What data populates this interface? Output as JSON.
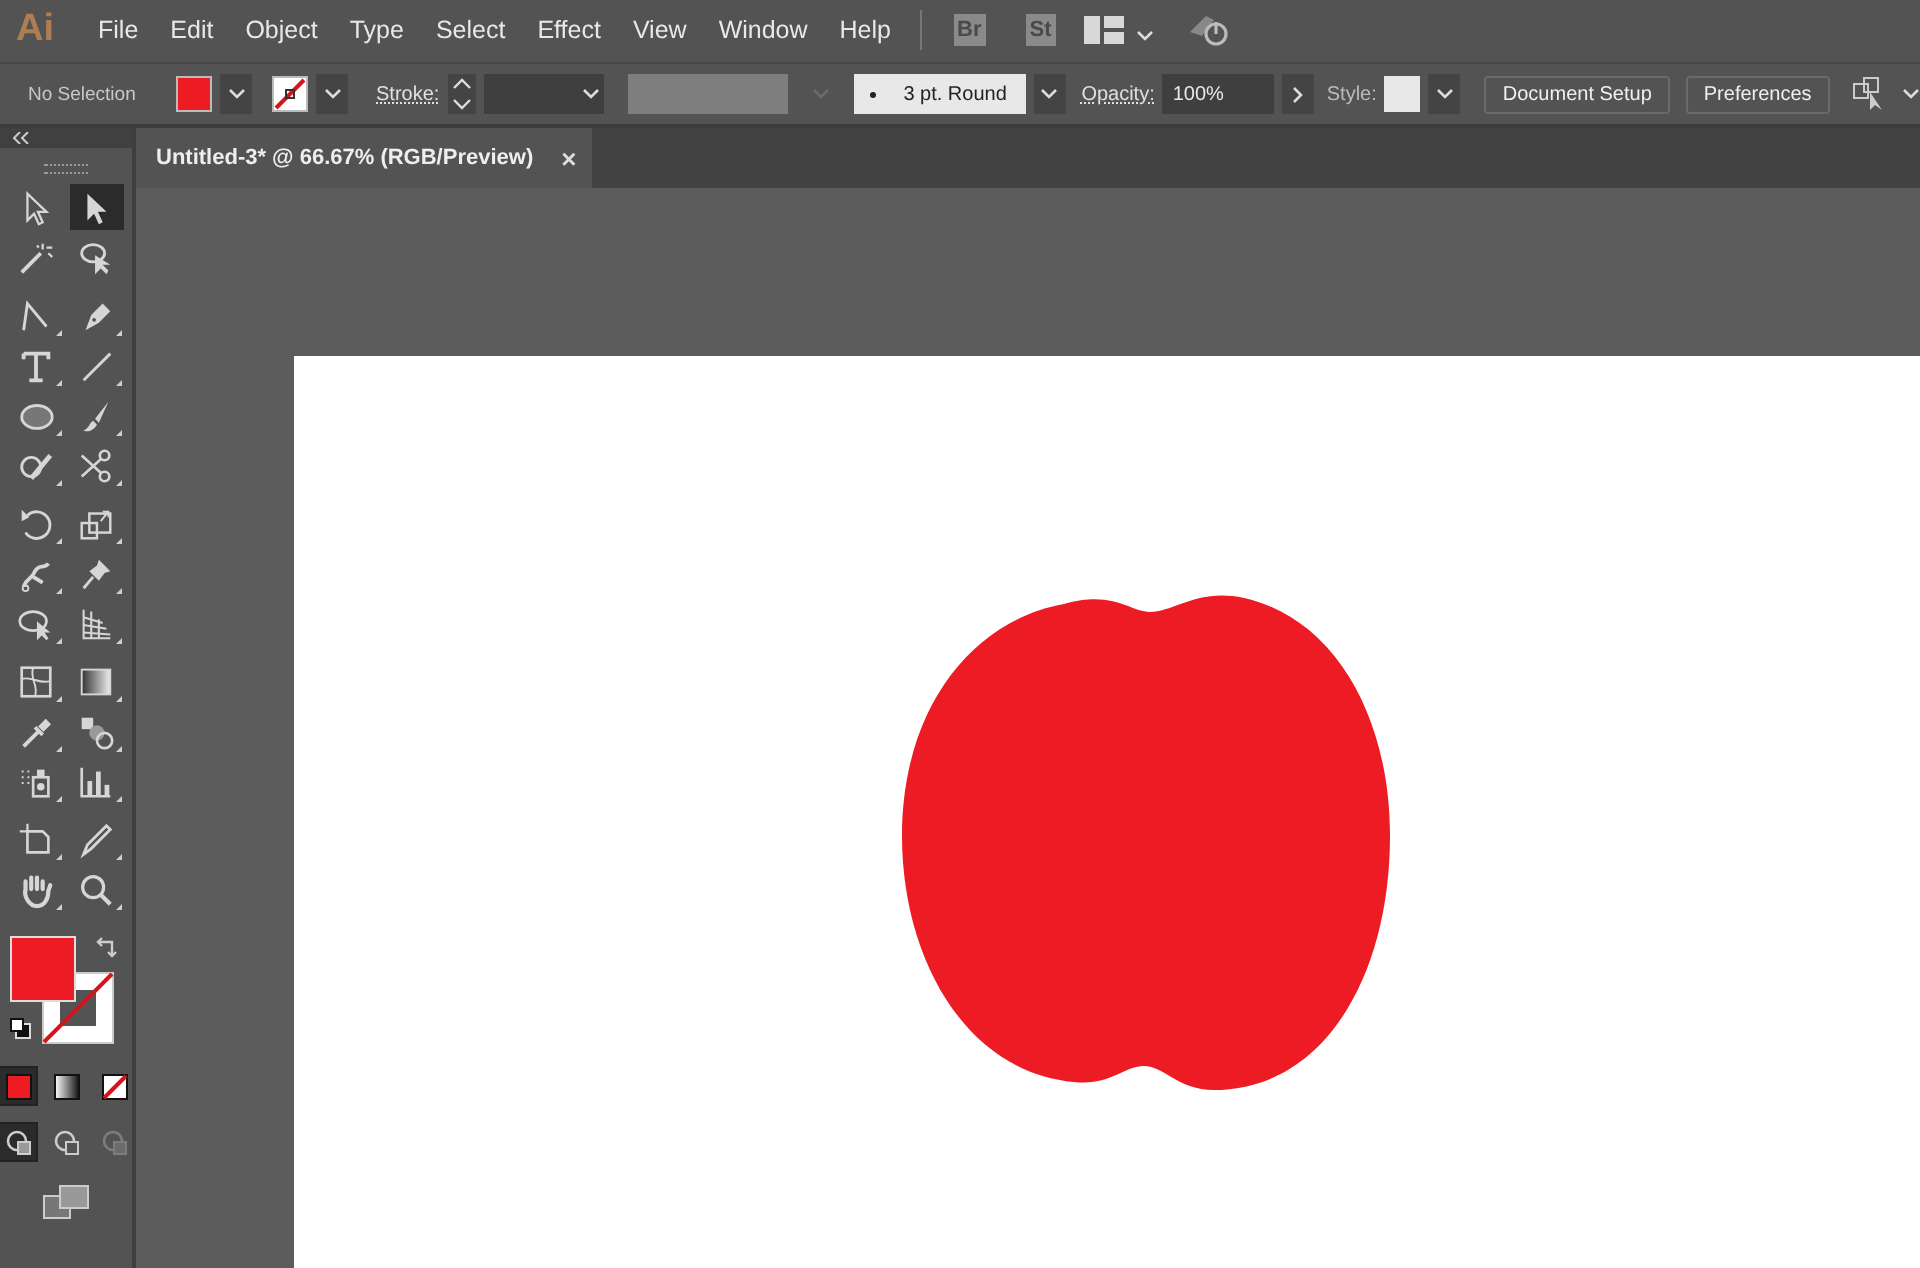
{
  "app_logo": "Ai",
  "menu": [
    "File",
    "Edit",
    "Object",
    "Type",
    "Select",
    "Effect",
    "View",
    "Window",
    "Help"
  ],
  "bridge_badges": [
    "Br",
    "St"
  ],
  "control_bar": {
    "selection_label": "No Selection",
    "fill": {
      "color": "#ed1c24"
    },
    "stroke_label": "Stroke:",
    "brush": "3 pt. Round",
    "opacity_label": "Opacity:",
    "opacity": "100%",
    "style_label": "Style:",
    "buttons": [
      "Document Setup",
      "Preferences"
    ]
  },
  "document_tab": {
    "title": "Untitled-3* @ 66.67% (RGB/Preview)",
    "close": "×",
    "selected": true
  },
  "tools": [
    {
      "kind": "direct-selection",
      "selected": false
    },
    {
      "kind": "selection",
      "selected": true
    },
    {
      "kind": "magic-wand",
      "selected": false
    },
    {
      "kind": "lasso",
      "selected": false
    },
    {
      "kind": "curvature",
      "selected": false
    },
    {
      "kind": "pen",
      "selected": false
    },
    {
      "kind": "type",
      "selected": false
    },
    {
      "kind": "line",
      "selected": false
    },
    {
      "kind": "ellipse",
      "selected": false
    },
    {
      "kind": "paintbrush",
      "selected": false
    },
    {
      "kind": "shaper",
      "selected": false
    },
    {
      "kind": "scissors",
      "selected": false
    },
    {
      "kind": "rotate",
      "selected": false
    },
    {
      "kind": "scale",
      "selected": false
    },
    {
      "kind": "puppet-warp",
      "selected": false
    },
    {
      "kind": "pin",
      "selected": false
    },
    {
      "kind": "shape-builder",
      "selected": false
    },
    {
      "kind": "perspective-grid",
      "selected": false
    },
    {
      "kind": "mesh",
      "selected": false
    },
    {
      "kind": "gradient",
      "selected": false
    },
    {
      "kind": "eyedropper",
      "selected": false
    },
    {
      "kind": "blend",
      "selected": false
    },
    {
      "kind": "symbol-sprayer",
      "selected": false
    },
    {
      "kind": "column-graph",
      "selected": false
    },
    {
      "kind": "artboard",
      "selected": false
    },
    {
      "kind": "slice",
      "selected": false
    },
    {
      "kind": "hand",
      "selected": false
    },
    {
      "kind": "zoom",
      "selected": false
    }
  ],
  "fill_stroke": {
    "color": "#ed1c24"
  },
  "color_modes": [
    {
      "kind": "color",
      "selected": true
    },
    {
      "kind": "gradient",
      "selected": false
    },
    {
      "kind": "none",
      "selected": false
    }
  ],
  "draw_modes": [
    {
      "kind": "normal",
      "selected": true
    },
    {
      "kind": "behind",
      "selected": false
    },
    {
      "kind": "inside",
      "selected": false
    }
  ],
  "artwork": {
    "color": "#ed1c24"
  }
}
